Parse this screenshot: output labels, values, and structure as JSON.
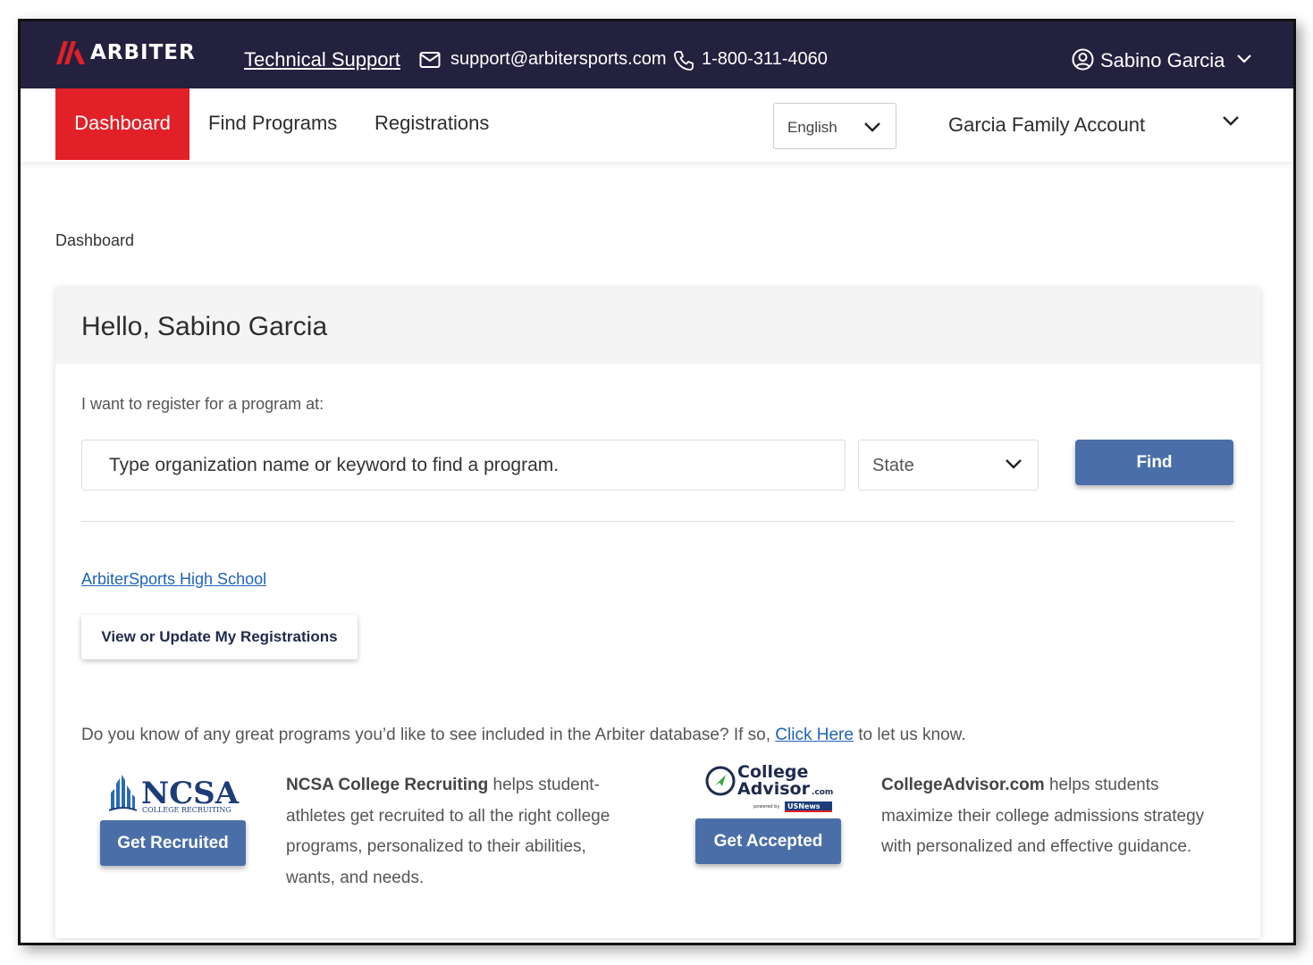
{
  "header": {
    "logo_text": "ARBITER",
    "tech_support": "Technical Support",
    "email": "support@arbitersports.com",
    "phone": "1-800-311-4060",
    "username": "Sabino Garcia",
    "colors": {
      "bar": "#24213f",
      "logo_red": "#e12027"
    }
  },
  "nav": {
    "tabs": [
      {
        "label": "Dashboard",
        "active": true
      },
      {
        "label": "Find Programs"
      },
      {
        "label": "Registrations"
      }
    ],
    "language": "English",
    "account": "Garcia Family Account"
  },
  "breadcrumb": "Dashboard",
  "card": {
    "greeting": "Hello, Sabino Garcia",
    "register_label": "I want to register for a program at:",
    "search_placeholder": "Type organization name or keyword to find a program.",
    "state_label": "State",
    "find_label": "Find",
    "school_link": "ArbiterSports High School",
    "view_registrations": "View or Update My Registrations",
    "know_prefix": "Do you know of any great programs you’d like to see included in the Arbiter database? If so, ",
    "know_link": "Click Here",
    "know_suffix": " to let us know."
  },
  "partners": {
    "ncsa": {
      "logo_text": "NCSA",
      "logo_sub": "COLLEGE RECRUITING",
      "button": "Get Recruited",
      "name": "NCSA College Recruiting",
      "desc": " helps student-athletes get recruited to all the right college programs, personalized to their abilities, wants, and needs."
    },
    "ca": {
      "logo_line1": "College",
      "logo_line2": "Advisor",
      "logo_com": ".com",
      "logo_powered": "powered by",
      "logo_usnews": "USNews",
      "button": "Get Accepted",
      "name": "CollegeAdvisor.com",
      "desc": " helps students maximize their college admissions strategy with personalized and effective guidance."
    }
  },
  "accent_color": "#4a6fa8"
}
